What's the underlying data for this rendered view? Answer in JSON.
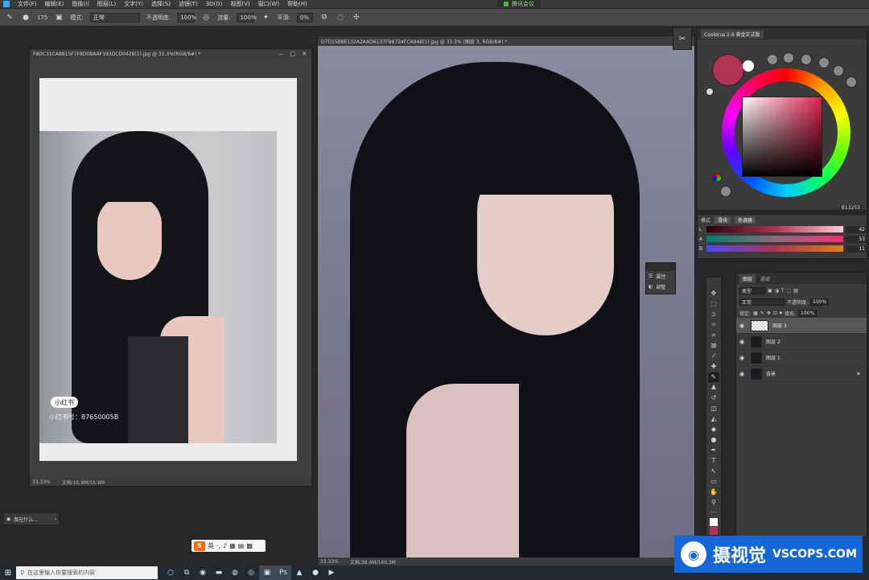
{
  "menubar": {
    "items": [
      "文件(F)",
      "编辑(E)",
      "图像(I)",
      "图层(L)",
      "文字(Y)",
      "选择(S)",
      "滤镜(T)",
      "3D(D)",
      "视图(V)",
      "窗口(W)",
      "帮助(H)"
    ],
    "meeting_label": "腾讯会议"
  },
  "options": {
    "brush_size": "175",
    "mode_label": "模式:",
    "mode_value": "正常",
    "opacity_label": "不透明度:",
    "opacity_value": "100%",
    "flow_label": "流量:",
    "flow_value": "100%",
    "smooth_label": "平滑:",
    "smooth_value": "0%"
  },
  "doc1": {
    "title": "F8DC31CA8815F7F8D0BAAF193DCD0428(1).jpg @ 33.3%(RGB/8#) *",
    "zoom": "33.33%",
    "doc_info": "文档:15.9M/15.9M",
    "watermark_badge": "小红书",
    "watermark_id": "小红书号：87650005B"
  },
  "doc2": {
    "title": "D7D15B8E132A2AAD6137FB8724FCA948(1).jpg @ 33.3% (图层 3, RGB/8#) *",
    "zoom": "33.33%",
    "doc_info": "文档:38.4M/140.3M"
  },
  "floatpanel": {
    "item1": "属性",
    "item2": "调整"
  },
  "colorpanel": {
    "tab": "Coolorus 2.6 黄金正式版",
    "current_color": "#b13253",
    "hex": "B13253"
  },
  "sliders": {
    "mode_label": "模式",
    "btn1": "滑块",
    "btn2": "色调器",
    "rows": [
      {
        "label": "L",
        "value": "42"
      },
      {
        "label": "A",
        "value": "53"
      },
      {
        "label": "B",
        "value": "11"
      }
    ]
  },
  "layers": {
    "tab_layers": "图层",
    "tab_channels": "通道",
    "kind_label": "类型",
    "blend_mode": "正常",
    "opacity_label": "不透明度:",
    "opacity_value": "100%",
    "lock_label": "锁定:",
    "fill_label": "填充:",
    "fill_value": "100%",
    "items": [
      {
        "name": "图层 3"
      },
      {
        "name": "图层 2"
      },
      {
        "name": "图层 1"
      },
      {
        "name": "背景"
      }
    ]
  },
  "searchhint": "我在什么...",
  "ime": {
    "logo": "S",
    "lang": "英"
  },
  "taskbar": {
    "search_placeholder": "在这里输入你要搜索的内容"
  },
  "brand": {
    "cn": "摄视觉",
    "en": "VSCOPS.COM"
  }
}
